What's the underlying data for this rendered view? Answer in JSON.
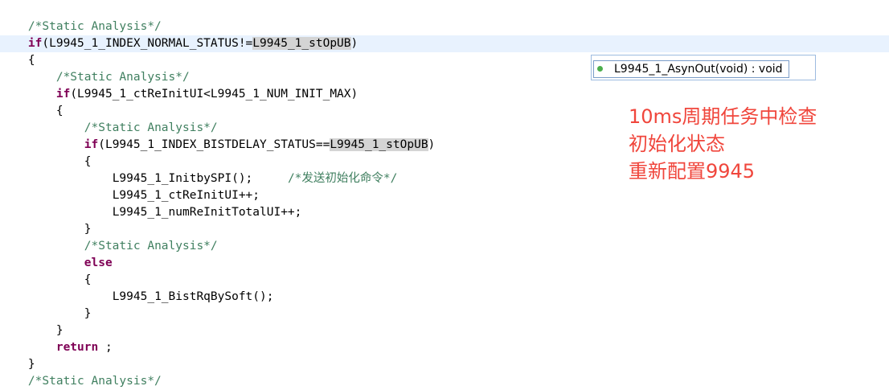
{
  "code": {
    "l1": "/*Static Analysis*/",
    "l2_kw": "if",
    "l2_a": "(L9945_1_INDEX_NORMAL_STATUS!=",
    "l2_hl": "L9945_1_stOpUB",
    "l2_b": ")",
    "l3": "{",
    "l4": "/*Static Analysis*/",
    "l5_kw": "if",
    "l5_a": "(L9945_1_ctReInitUI<L9945_1_NUM_INIT_MAX)",
    "l6": "{",
    "l7": "/*Static Analysis*/",
    "l8_kw": "if",
    "l8_a": "(L9945_1_INDEX_BISTDELAY_STATUS==",
    "l8_hl": "L9945_1_stOpUB",
    "l8_b": ")",
    "l9": "{",
    "l10_code": "L9945_1_InitbySPI();",
    "l10_comment": "/*发送初始化命令*/",
    "l11": "L9945_1_ctReInitUI++;",
    "l12": "L9945_1_numReInitTotalUI++;",
    "l13": "}",
    "l14": "/*Static Analysis*/",
    "l15_kw": "else",
    "l16": "{",
    "l17": "L9945_1_BistRqBySoft();",
    "l18": "}",
    "l19": "}",
    "l20_kw": "return",
    "l20_a": " ;",
    "l21": "}",
    "l22": "/*Static Analysis*/"
  },
  "autocomplete": {
    "item_label": "L9945_1_AsynOut(void) : void",
    "dot_color": "#4cae4c"
  },
  "annotation": {
    "line1": "10ms周期任务中检查",
    "line2": "初始化状态",
    "line3": "重新配置9945",
    "color": "#f0463c"
  },
  "colors": {
    "keyword": "#7f0055",
    "comment": "#3f7f5f",
    "current_line": "#e8f2fe",
    "highlight": "#d4d4d4"
  }
}
